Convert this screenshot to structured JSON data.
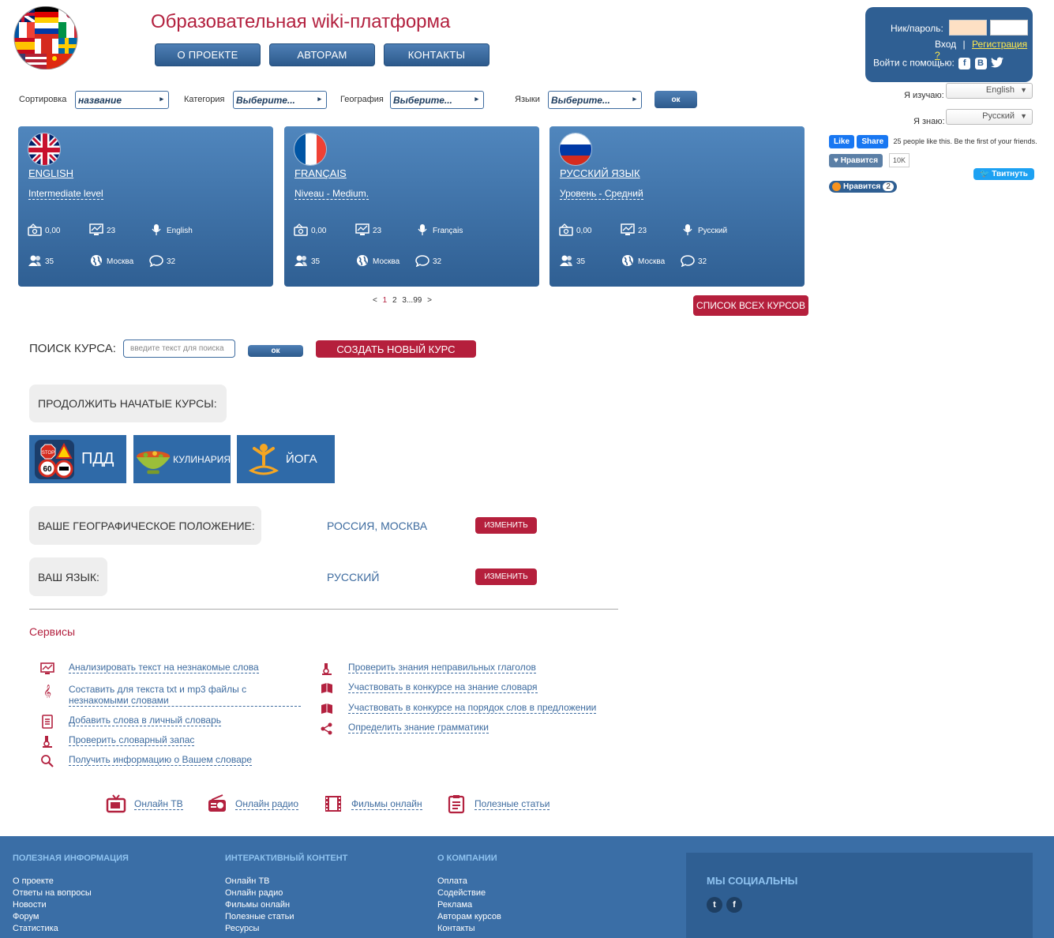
{
  "header": {
    "title": "Образовательная wiki-платформа",
    "nav": [
      "О ПРОЕКТЕ",
      "АВТОРАМ",
      "КОНТАКТЫ"
    ]
  },
  "login": {
    "nick_label": "Ник/пароль:",
    "login_link": "Вход",
    "separator": "|",
    "register_link": "Регистрация ?",
    "social_label": "Войти с помощью:",
    "social_icons": [
      "facebook-icon",
      "vk-icon",
      "twitter-icon"
    ]
  },
  "languages": {
    "learning_label": "Я изучаю:",
    "learning_value": "English",
    "known_label": "Я знаю:",
    "known_value": "Русский"
  },
  "social_widgets": {
    "fb_like": "Like",
    "fb_share": "Share",
    "fb_text": "25 people like this. Be the first of your friends.",
    "vk_label": "Нравится",
    "vk_count": "10K",
    "tweet_label": "Твитнуть",
    "ok_label": "Нравится",
    "ok_count": "2"
  },
  "filters": {
    "sort_label": "Сортировка",
    "sort_value": "название",
    "category_label": "Категория",
    "category_value": "Выберите...",
    "geo_label": "География",
    "geo_value": "Выберите...",
    "lang_label": "Языки",
    "lang_value": "Выберите...",
    "ok": "ок"
  },
  "courses": [
    {
      "name": "ENGLISH",
      "level": "Intermediate level",
      "price": "0,00",
      "stat": "23",
      "lang": "English",
      "users": "35",
      "city": "Москва",
      "comments": "32",
      "flag": "uk"
    },
    {
      "name": "FRANÇAIS",
      "level": "Niveau - Medium.",
      "price": "0,00",
      "stat": "23",
      "lang": "Français",
      "users": "35",
      "city": "Москва",
      "comments": "32",
      "flag": "fr"
    },
    {
      "name": "РУССКИЙ ЯЗЫК",
      "level": "Уровень - Средний",
      "price": "0,00",
      "stat": "23",
      "lang": "Русский",
      "users": "35",
      "city": "Москва",
      "comments": "32",
      "flag": "ru"
    }
  ],
  "pager": {
    "prev": "<",
    "pages": [
      "1",
      "2",
      "3",
      "...",
      "99"
    ],
    "next": ">"
  },
  "all_courses_button": "СПИСОК ВСЕХ КУРСОВ",
  "search": {
    "label": "ПОИСК КУРСА:",
    "placeholder": "введите текст для поиска",
    "ok": "ок",
    "create_button": "СОЗДАТЬ НОВЫЙ КУРС"
  },
  "continue": {
    "label": "ПРОДОЛЖИТЬ НАЧАТЫЕ КУРСЫ:",
    "items": [
      "ПДД",
      "КУЛИНАРИЯ",
      "ЙОГА"
    ]
  },
  "geo": {
    "label": "ВАШЕ ГЕОГРАФИЧЕСКОЕ ПОЛОЖЕНИЕ:",
    "value": "РОССИЯ, МОСКВА",
    "button": "ИЗМЕНИТЬ"
  },
  "lang": {
    "label": "ВАШ ЯЗЫК:",
    "value": "РУССКИЙ",
    "button": "ИЗМЕНИТЬ"
  },
  "services": {
    "title": "Сервисы",
    "left": [
      "Анализировать текст на незнакомые слова",
      "Составить для текста txt и mp3 файлы с незнакомыми словами",
      "Добавить слова в личный словарь",
      "Проверить словарный запас",
      "Получить информацию о Вашем словаре"
    ],
    "right": [
      "Проверить знания неправильных глаголов",
      "Участвовать в конкурсе на знание словаря",
      "Участвовать в конкурсе на порядок слов в предложении",
      "Определить знание грамматики"
    ]
  },
  "media": [
    "Онлайн ТВ",
    "Онлайн радио",
    "Фильмы онлайн",
    "Полезные статьи"
  ],
  "footer": {
    "col1": {
      "title": "ПОЛЕЗНАЯ ИНФОРМАЦИЯ",
      "items": [
        "О проекте",
        "Ответы на вопросы",
        "Новости",
        "Форум",
        "Статистика"
      ]
    },
    "col2": {
      "title": "ИНТЕРАКТИВНЫЙ КОНТЕНТ",
      "items": [
        "Онлайн ТВ",
        "Онлайн радио",
        "Фильмы онлайн",
        "Полезные статьи",
        "Ресурсы"
      ]
    },
    "col3": {
      "title": "О КОМПАНИИ",
      "items": [
        "Оплата",
        "Содействие",
        "Реклама",
        "Авторам курсов",
        "Контакты"
      ]
    },
    "social_title": "МЫ СОЦИАЛЬНЫ"
  },
  "colors": {
    "accent_red": "#b3213f",
    "primary_blue": "#2f5f93",
    "footer_blue": "#3a6ea6"
  }
}
